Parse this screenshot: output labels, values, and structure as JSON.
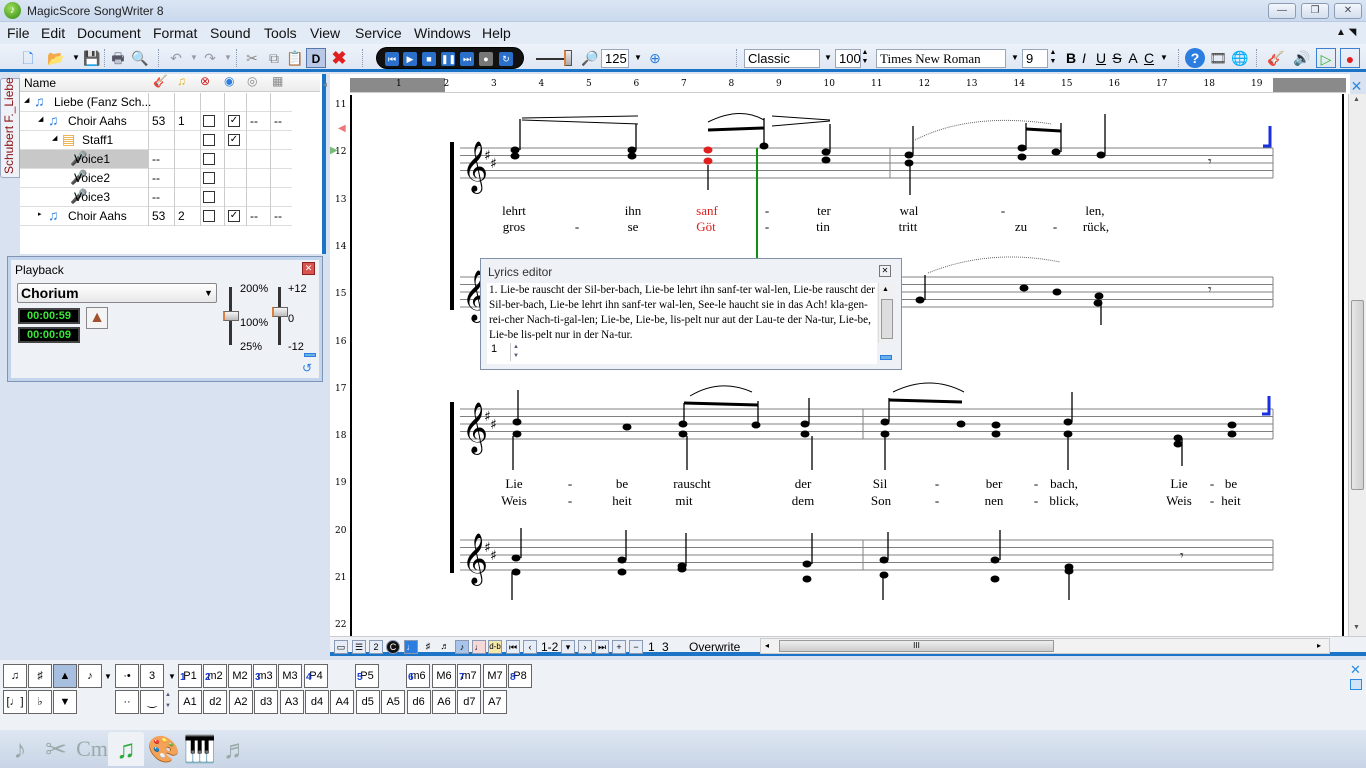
{
  "window": {
    "title": "MagicScore SongWriter 8",
    "min": "—",
    "max": "❐",
    "close": "✕"
  },
  "menu": [
    "File",
    "Edit",
    "Document",
    "Format",
    "Sound",
    "Tools",
    "View",
    "Service",
    "Windows",
    "Help"
  ],
  "toolbar": {
    "zoom_value": "125",
    "style_value": "Classic",
    "size_value": "100",
    "font_value": "Times New Roman",
    "font_size_value": "9",
    "bold": "B",
    "italic": "I",
    "underline": "U",
    "strike": "S",
    "text_a": "A",
    "text_c": "C",
    "d_button": "D"
  },
  "side_tab": "Schubert F._Liebe",
  "tree": {
    "header_name": "Name",
    "rows": [
      {
        "name": "Liebe (Fanz Sch...",
        "prog": "",
        "ch": "",
        "mute": false,
        "solo": null,
        "c5": "",
        "c6": ""
      },
      {
        "name": "Choir Aahs",
        "prog": "53",
        "ch": "1",
        "mute": false,
        "solo": true,
        "c5": "--",
        "c6": "--"
      },
      {
        "name": "Staff1",
        "prog": "",
        "ch": "",
        "mute": false,
        "solo": true,
        "c5": "",
        "c6": ""
      },
      {
        "name": "Voice1",
        "prog": "--",
        "ch": "",
        "mute": false,
        "solo": null,
        "c5": "",
        "c6": ""
      },
      {
        "name": "Voice2",
        "prog": "--",
        "ch": "",
        "mute": false,
        "solo": null,
        "c5": "",
        "c6": ""
      },
      {
        "name": "Voice3",
        "prog": "--",
        "ch": "",
        "mute": false,
        "solo": null,
        "c5": "",
        "c6": ""
      },
      {
        "name": "Choir Aahs",
        "prog": "53",
        "ch": "2",
        "mute": false,
        "solo": true,
        "c5": "--",
        "c6": "--"
      }
    ]
  },
  "playback": {
    "title": "Playback",
    "instrument": "Chorium",
    "time_total": "00:00:59",
    "time_current": "00:00:09",
    "tempo_labels": [
      "200%",
      "100%",
      "25%"
    ],
    "transpose_labels": [
      "+12",
      "0",
      "-12"
    ],
    "tempo_percent": 100,
    "transpose_semitones": 0
  },
  "score": {
    "ruler_h": [
      "1",
      "2",
      "3",
      "4",
      "5",
      "6",
      "7",
      "8",
      "9",
      "10",
      "11",
      "12",
      "13",
      "14",
      "15",
      "16",
      "17",
      "18",
      "19"
    ],
    "ruler_v": [
      "11",
      "12",
      "13",
      "14",
      "15",
      "16",
      "17",
      "18",
      "19",
      "20",
      "21",
      "22"
    ],
    "system1_line1": [
      {
        "t": "lehrt"
      },
      {
        "t": "ihn"
      },
      {
        "t": "sanf",
        "hl": true
      },
      {
        "t": "-"
      },
      {
        "t": "ter"
      },
      {
        "t": "wal"
      },
      {
        "t": "-"
      },
      {
        "t": "len,"
      }
    ],
    "system1_line2": [
      {
        "t": "gros"
      },
      {
        "t": "-"
      },
      {
        "t": "se"
      },
      {
        "t": "Göt",
        "hl": true
      },
      {
        "t": "-"
      },
      {
        "t": "tin"
      },
      {
        "t": "tritt"
      },
      {
        "t": "zu"
      },
      {
        "t": "-"
      },
      {
        "t": "rück,"
      }
    ],
    "system2_line1": [
      {
        "t": "Lie"
      },
      {
        "t": "-"
      },
      {
        "t": "be"
      },
      {
        "t": "rauscht"
      },
      {
        "t": "der"
      },
      {
        "t": "Sil"
      },
      {
        "t": "-"
      },
      {
        "t": "ber"
      },
      {
        "t": "-"
      },
      {
        "t": "bach,"
      },
      {
        "t": "Lie"
      },
      {
        "t": "-"
      },
      {
        "t": "be"
      }
    ],
    "system2_line2": [
      {
        "t": "Weis"
      },
      {
        "t": "-"
      },
      {
        "t": "heit"
      },
      {
        "t": "mit"
      },
      {
        "t": "dem"
      },
      {
        "t": "Son"
      },
      {
        "t": "-"
      },
      {
        "t": "nen"
      },
      {
        "t": "-"
      },
      {
        "t": "blick,"
      },
      {
        "t": "Weis"
      },
      {
        "t": "-"
      },
      {
        "t": "heit"
      }
    ]
  },
  "lyrics_editor": {
    "title": "Lyrics editor",
    "text": "1.  Lie-be rauscht der Sil-ber-bach, Lie-be lehrt ihn sanf-ter wal-len, Lie-be rauscht der Sil-ber-bach, Lie-be lehrt ihn sanf-ter wal-len, See-le haucht sie in das Ach! kla-gen-rei-cher Nach-ti-gal-len; Lie-be, Lie-be, lis-pelt nur aut der Lau-te der Na-tur, Lie-be, Lie-be lis-pelt nur in der Na-tur.",
    "verse": "1"
  },
  "statusbar": {
    "page_range": "1-2",
    "page_a": "1",
    "page_b": "3",
    "mode": "Overwrite"
  },
  "palette": {
    "row1": [
      {
        "l": "P1",
        "n": "1"
      },
      {
        "l": "m2",
        "n": "2"
      },
      {
        "l": "M2",
        "n": ""
      },
      {
        "l": "m3",
        "n": "3"
      },
      {
        "l": "M3",
        "n": ""
      },
      {
        "l": "P4",
        "n": "4"
      },
      {
        "l": "P5",
        "n": "5"
      },
      {
        "l": "m6",
        "n": "6"
      },
      {
        "l": "M6",
        "n": ""
      },
      {
        "l": "m7",
        "n": "7"
      },
      {
        "l": "M7",
        "n": ""
      },
      {
        "l": "P8",
        "n": "8"
      }
    ],
    "row2": [
      "A1",
      "d2",
      "A2",
      "d3",
      "A3",
      "d4",
      "A4",
      "d5",
      "A5",
      "d6",
      "A6",
      "d7",
      "A7"
    ],
    "tuplet": "3",
    "tabs": [
      "note-tab",
      "tools-tab",
      "chord-tab",
      "lyrics-tab",
      "palette-tab",
      "keyboard-tab",
      "mixer-tab"
    ]
  },
  "colors": {
    "accent": "#1c74c7",
    "highlight": "#e0201e",
    "cursor": "#109010",
    "lcd": "#38e638"
  }
}
